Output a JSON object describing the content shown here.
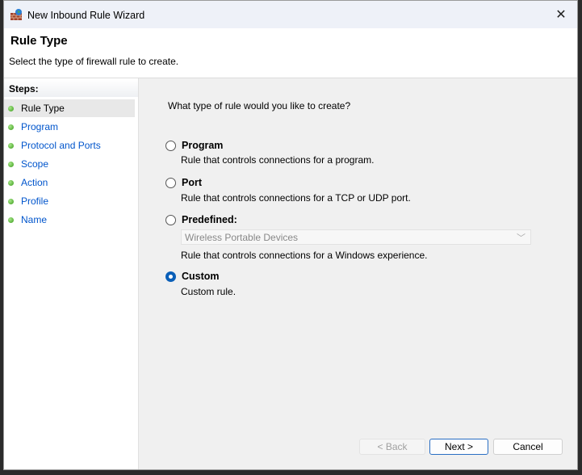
{
  "window": {
    "title": "New Inbound Rule Wizard",
    "close_label": "✕"
  },
  "header": {
    "title": "Rule Type",
    "subtitle": "Select the type of firewall rule to create."
  },
  "steps": {
    "heading": "Steps:",
    "items": [
      {
        "label": "Rule Type",
        "active": true
      },
      {
        "label": "Program"
      },
      {
        "label": "Protocol and Ports"
      },
      {
        "label": "Scope"
      },
      {
        "label": "Action"
      },
      {
        "label": "Profile"
      },
      {
        "label": "Name"
      }
    ]
  },
  "main": {
    "question": "What type of rule would you like to create?",
    "options": [
      {
        "label": "Program",
        "description": "Rule that controls connections for a program.",
        "selected": false
      },
      {
        "label": "Port",
        "description": "Rule that controls connections for a TCP or UDP port.",
        "selected": false
      },
      {
        "label": "Predefined:",
        "description": "Rule that controls connections for a Windows experience.",
        "selected": false
      },
      {
        "label": "Custom",
        "description": "Custom rule.",
        "selected": true
      }
    ],
    "predefined_value": "Wireless Portable Devices"
  },
  "buttons": {
    "back": "< Back",
    "next": "Next >",
    "cancel": "Cancel"
  },
  "colors": {
    "accent": "#0a5fb8",
    "link": "#0055cc"
  }
}
